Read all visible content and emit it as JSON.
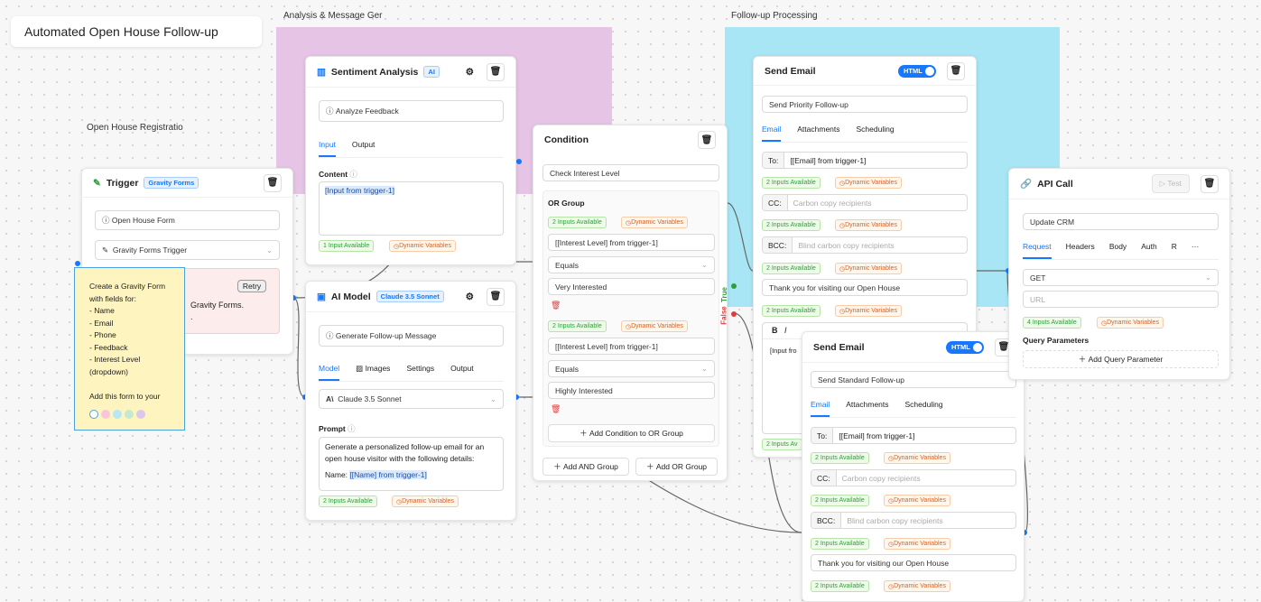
{
  "title": "Automated Open House Follow-up",
  "groups": {
    "registration": "Open House Registratio",
    "analysis": "Analysis & Message Ger",
    "followup": "Follow-up Processing",
    "analysis_color": "#e6c4e6",
    "followup_color": "#a8e6f5"
  },
  "trigger": {
    "title": "Trigger",
    "badge": "Gravity Forms",
    "form": "Open House Form",
    "type": "Gravity Forms Trigger",
    "retry": "Retry",
    "error_line1": "Gravity Forms.",
    "error_line2": "."
  },
  "note": {
    "lines": [
      "Create a Gravity Form",
      "with fields for:",
      "- Name",
      "- Email",
      "- Phone",
      "- Feedback",
      "- Interest Level",
      "(dropdown)",
      "",
      "Add this form to your"
    ],
    "colors": [
      "#ffffff",
      "#f8c6d8",
      "#b8e6f5",
      "#c6e8cf",
      "#dcc6ec"
    ]
  },
  "sentiment": {
    "title": "Sentiment Analysis",
    "badge": "AI",
    "name": "Analyze Feedback",
    "tabs": [
      "Input",
      "Output"
    ],
    "content_label": "Content",
    "content": "[Input from trigger-1]",
    "inputs": "1 Input Available",
    "dyn": "Dynamic Variables"
  },
  "ai_model": {
    "title": "AI Model",
    "badge": "Claude 3.5 Sonnet",
    "name": "Generate Follow-up Message",
    "tabs": [
      "Model",
      "Images",
      "Settings",
      "Output"
    ],
    "model": "Claude 3.5 Sonnet",
    "prompt_label": "Prompt",
    "prompt": "Generate a personalized follow-up email for an open house visitor with the following details:",
    "prompt_name": "Name: ",
    "prompt_var": "[[Name] from trigger-1]",
    "inputs": "2 Inputs Available",
    "dyn": "Dynamic Variables"
  },
  "condition": {
    "title": "Condition",
    "name": "Check Interest Level",
    "group": "OR Group",
    "inputs": "2 Inputs Available",
    "dyn": "Dynamic Variables",
    "rules": [
      {
        "field": "[[Interest Level] from trigger-1]",
        "op": "Equals",
        "value": "Very Interested"
      },
      {
        "field": "[[Interest Level] from trigger-1]",
        "op": "Equals",
        "value": "Highly Interested"
      }
    ],
    "add_cond": "Add Condition to OR Group",
    "add_and": "Add AND Group",
    "add_or": "Add OR Group",
    "true_label": "True",
    "false_label": "False"
  },
  "email1": {
    "title": "Send Email",
    "toggle": "HTML",
    "name": "Send Priority Follow-up",
    "tabs": [
      "Email",
      "Attachments",
      "Scheduling"
    ],
    "to_label": "To:",
    "to": "[[Email] from trigger-1]",
    "cc_label": "CC:",
    "cc_ph": "Carbon copy recipients",
    "bcc_label": "BCC:",
    "bcc_ph": "Blind carbon copy recipients",
    "subject": "Thank you for visiting our Open House",
    "body": "[Input fro",
    "inputs": "2 Inputs Available",
    "inputs_short": "2 Inputs Av",
    "dyn": "Dynamic Variables"
  },
  "email2": {
    "title": "Send Email",
    "toggle": "HTML",
    "name": "Send Standard Follow-up",
    "tabs": [
      "Email",
      "Attachments",
      "Scheduling"
    ],
    "to_label": "To:",
    "to": "[[Email] from trigger-1]",
    "cc_label": "CC:",
    "cc_ph": "Carbon copy recipients",
    "bcc_label": "BCC:",
    "bcc_ph": "Blind carbon copy recipients",
    "subject": "Thank you for visiting our Open House",
    "inputs": "2 Inputs Available",
    "dyn": "Dynamic Variables"
  },
  "api": {
    "title": "API Call",
    "test": "Test",
    "name": "Update CRM",
    "tabs": [
      "Request",
      "Headers",
      "Body",
      "Auth",
      "R"
    ],
    "more": "···",
    "method": "GET",
    "url_ph": "URL",
    "inputs": "4 Inputs Available",
    "dyn": "Dynamic Variables",
    "qp_label": "Query Parameters",
    "add_qp": "Add Query Parameter"
  }
}
